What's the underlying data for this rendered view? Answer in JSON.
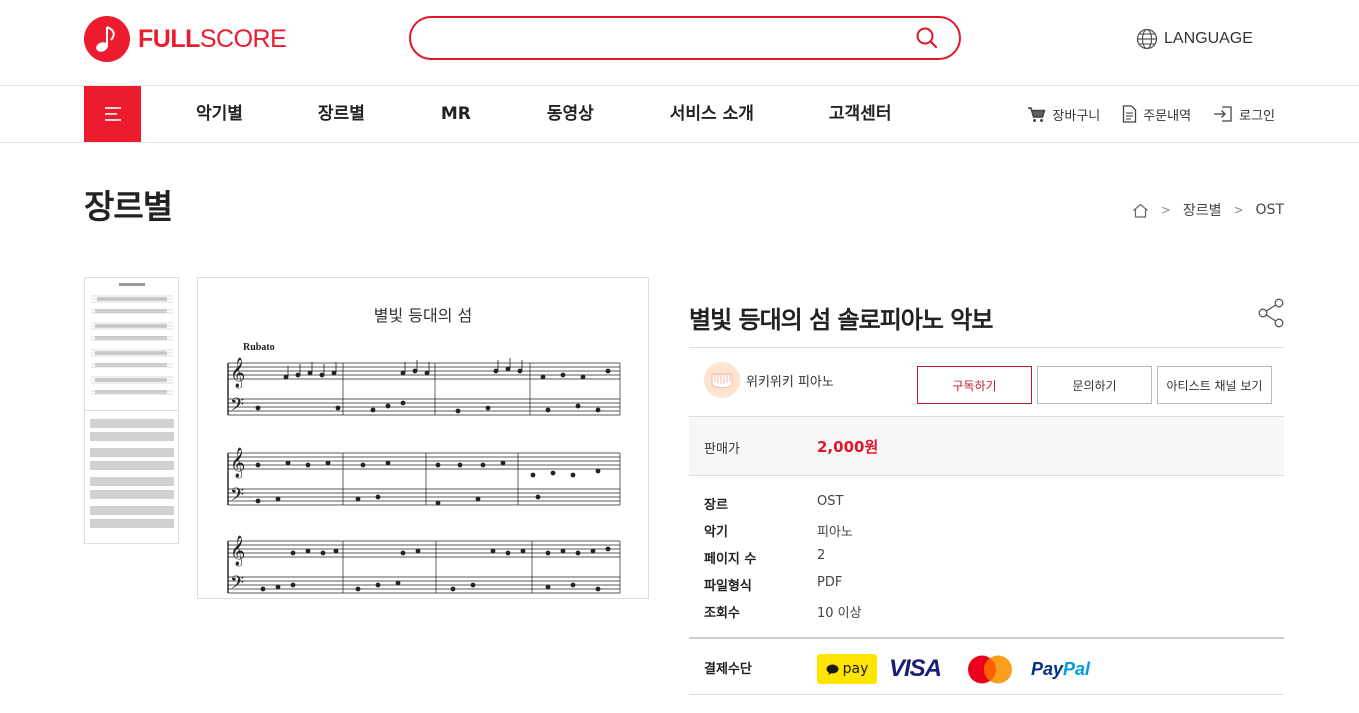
{
  "header": {
    "logo_bold": "FULL",
    "logo_light": "SCORE",
    "search_placeholder": "",
    "language_label": "LANGUAGE"
  },
  "nav": {
    "items": [
      {
        "label": "악기별"
      },
      {
        "label": "장르별"
      },
      {
        "label": "MR"
      },
      {
        "label": "동영상"
      },
      {
        "label": "서비스 소개"
      },
      {
        "label": "고객센터"
      }
    ],
    "util": {
      "cart": "장바구니",
      "orders": "주문내역",
      "login": "로그인"
    }
  },
  "page": {
    "title": "장르별",
    "breadcrumb": [
      "장르별",
      "OST"
    ]
  },
  "preview": {
    "title": "별빛 등대의 섬",
    "tempo": "Rubato"
  },
  "product": {
    "title": "별빛 등대의 섬 솔로피아노 악보",
    "artist": "위키위키 피아노",
    "buttons": {
      "subscribe": "구독하기",
      "inquire": "문의하기",
      "channel": "아티스트 채널 보기"
    },
    "price_label": "판매가",
    "price": "2,000원",
    "specs": [
      {
        "key": "장르",
        "value": "OST"
      },
      {
        "key": "악기",
        "value": "피아노"
      },
      {
        "key": "페이지 수",
        "value": "2"
      },
      {
        "key": "파일형식",
        "value": "PDF"
      },
      {
        "key": "조회수",
        "value": "10 이상"
      }
    ],
    "payment_label": "결제수단",
    "payment": {
      "kakaopay": "pay",
      "visa": "VISA",
      "paypal_1": "Pay",
      "paypal_2": "Pal"
    }
  },
  "colors": {
    "brand_red": "#ec1b2e",
    "price_red": "#e0162b"
  }
}
